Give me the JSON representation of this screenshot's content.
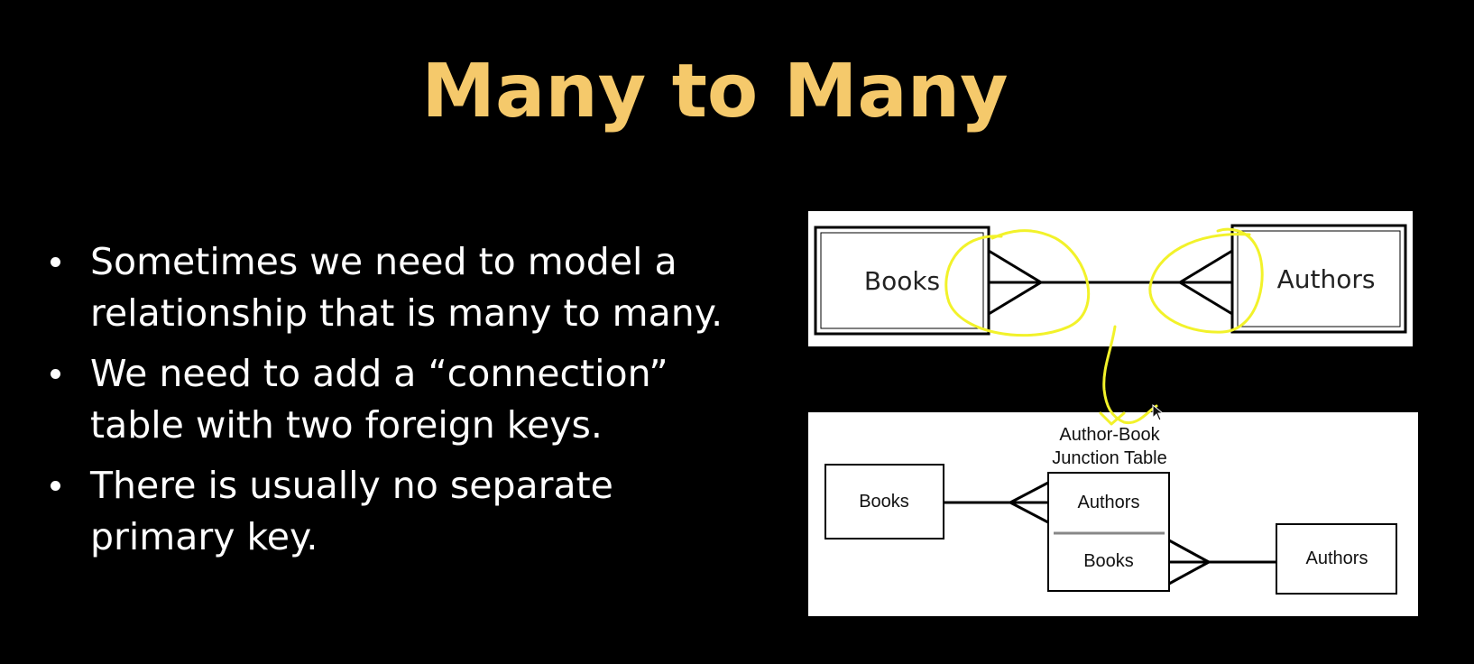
{
  "slide": {
    "title": "Many to Many",
    "bullets": [
      "Sometimes we need to model a relationship that is many to many.",
      "We need to add a “connection” table with two foreign keys.",
      "There is usually no separate primary key."
    ]
  },
  "diagram_top": {
    "left_entity": "Books",
    "right_entity": "Authors",
    "relationship": "many-to-many"
  },
  "diagram_bottom": {
    "junction_title_line1": "Author-Book",
    "junction_title_line2": "Junction Table",
    "left_entity": "Books",
    "junction_field_top": "Authors",
    "junction_field_bottom": "Books",
    "right_entity": "Authors"
  },
  "colors": {
    "title": "#F5C96B",
    "annotation": "#F2F22A",
    "background": "#000000"
  }
}
